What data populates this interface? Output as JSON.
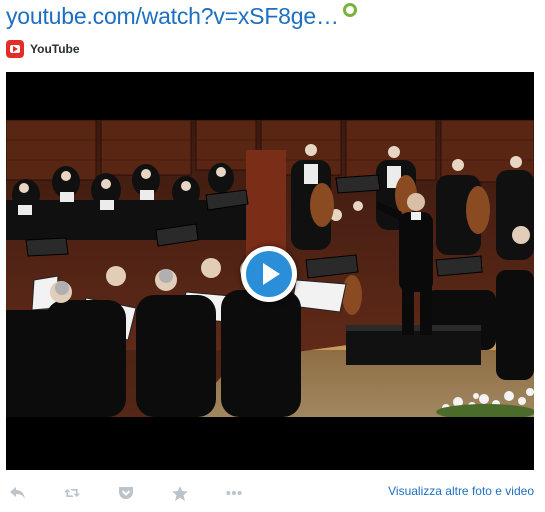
{
  "card": {
    "title": "youtube.com/watch?v=xSF8ge…",
    "source": "YouTube"
  },
  "video": {
    "play_label": "Play video"
  },
  "actions": {
    "icons": [
      "reply-icon",
      "retweet-icon",
      "pocket-icon",
      "favorite-icon",
      "more-icon"
    ],
    "view_more": "Visualizza altre foto e video"
  },
  "colors": {
    "link": "#1d6fc0",
    "icon_gray": "#bcc3c9",
    "youtube_red": "#e52d27",
    "play_blue": "#2a8fd8",
    "status_green": "#79b33b"
  }
}
